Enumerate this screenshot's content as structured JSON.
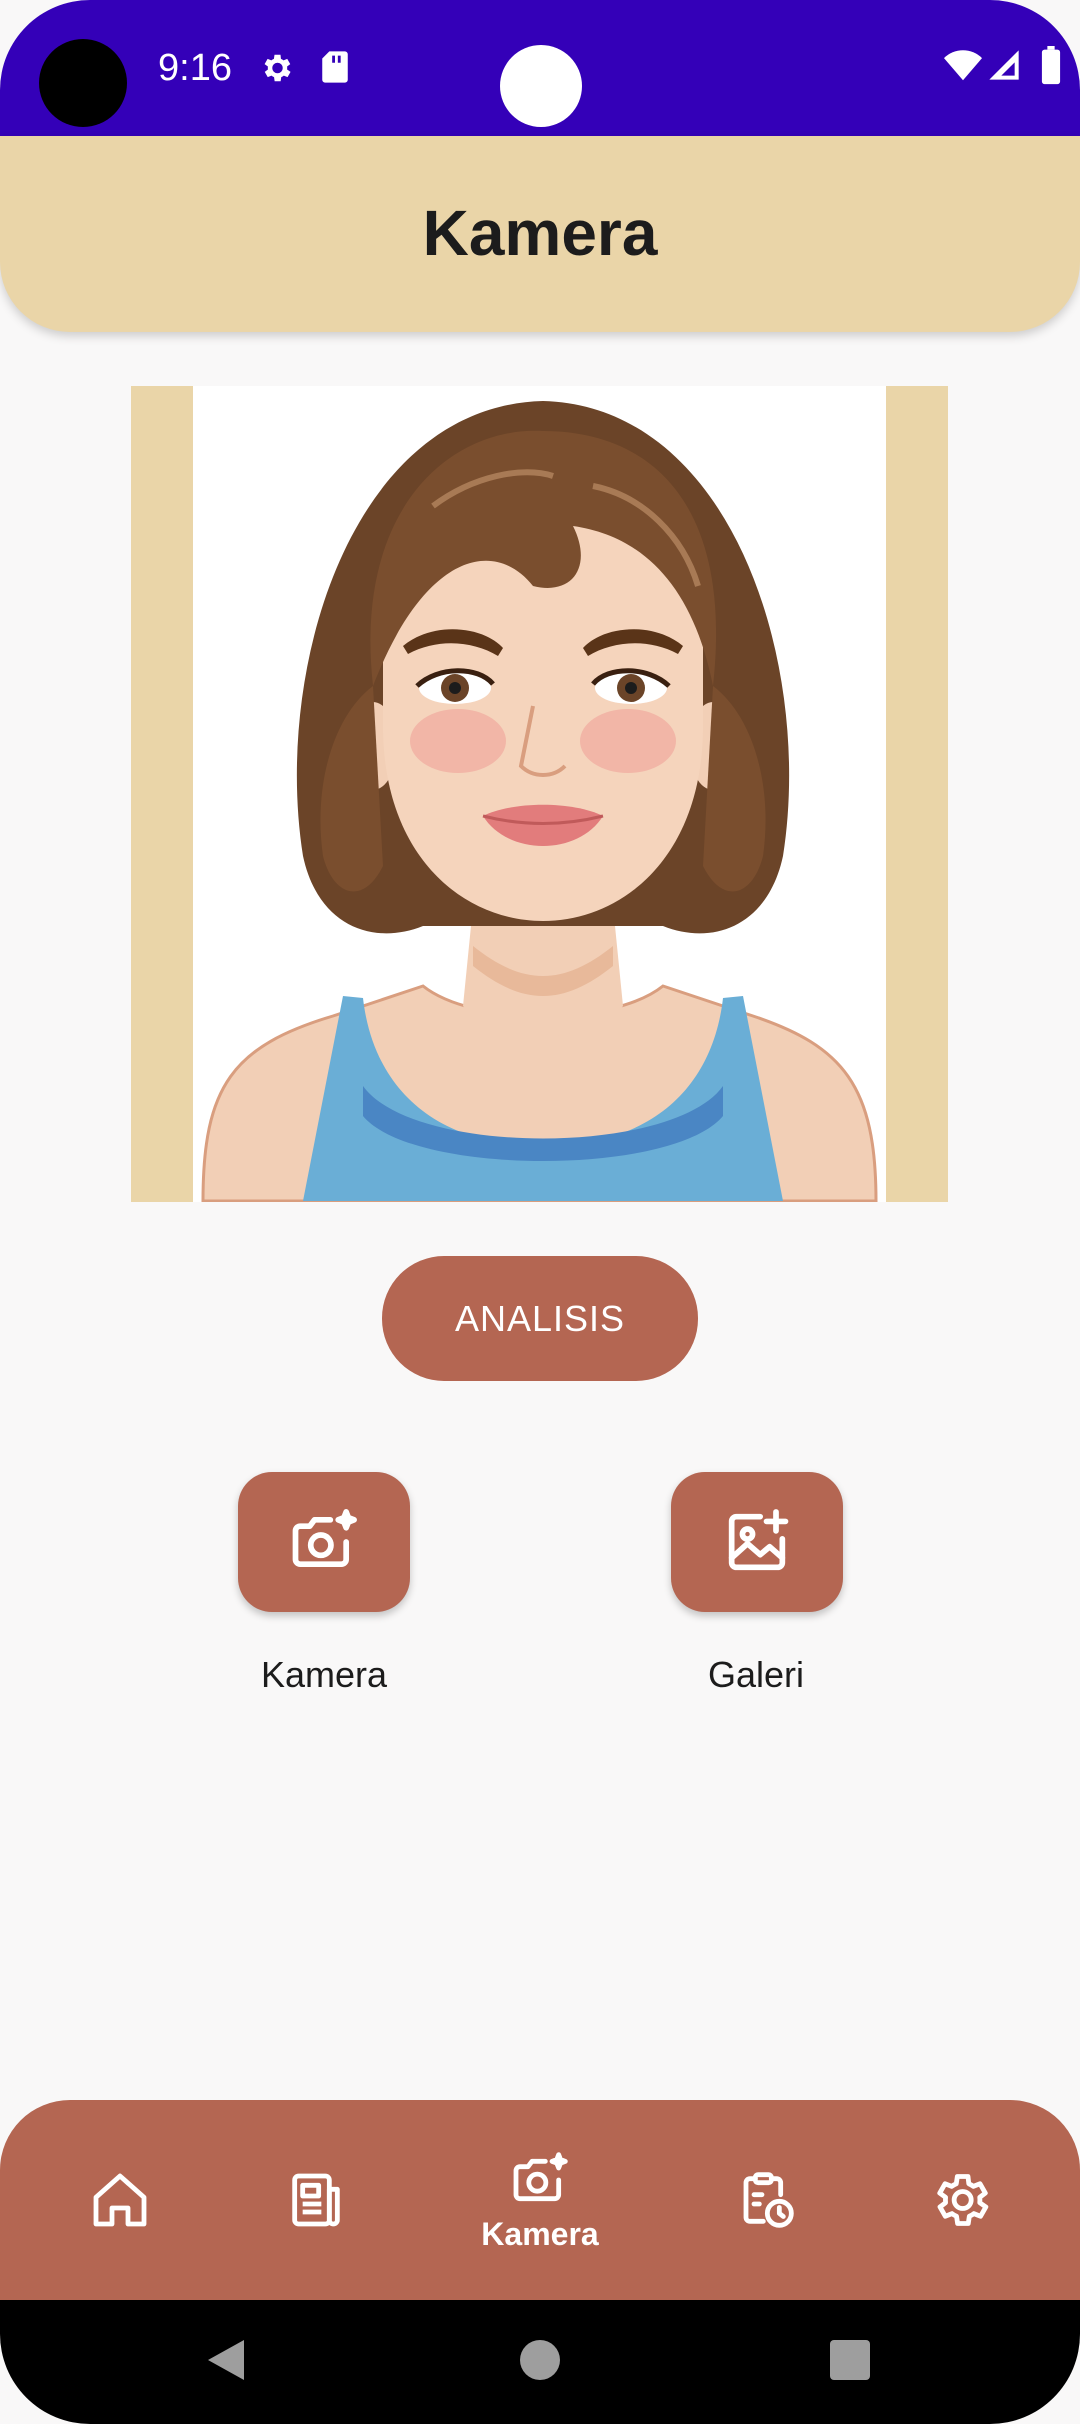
{
  "status_bar": {
    "time": "9:16",
    "icons": [
      "gear-icon",
      "sd-card-icon",
      "wifi-icon",
      "signal-icon",
      "battery-icon"
    ]
  },
  "app_bar": {
    "title": "Kamera"
  },
  "main": {
    "analyze_button_label": "ANALISIS",
    "actions": [
      {
        "label": "Kamera",
        "icon": "camera-sparkle-icon"
      },
      {
        "label": "Galeri",
        "icon": "gallery-add-icon"
      }
    ]
  },
  "bottom_nav": {
    "items": [
      {
        "icon": "home-icon",
        "label": ""
      },
      {
        "icon": "news-icon",
        "label": ""
      },
      {
        "icon": "camera-sparkle-icon",
        "label": "Kamera",
        "active": true
      },
      {
        "icon": "calendar-clock-icon",
        "label": ""
      },
      {
        "icon": "settings-icon",
        "label": ""
      }
    ]
  },
  "colors": {
    "status_bar": "#3400b8",
    "app_bar": "#ead5a8",
    "accent": "#b46652",
    "background": "#f9f8f8"
  }
}
